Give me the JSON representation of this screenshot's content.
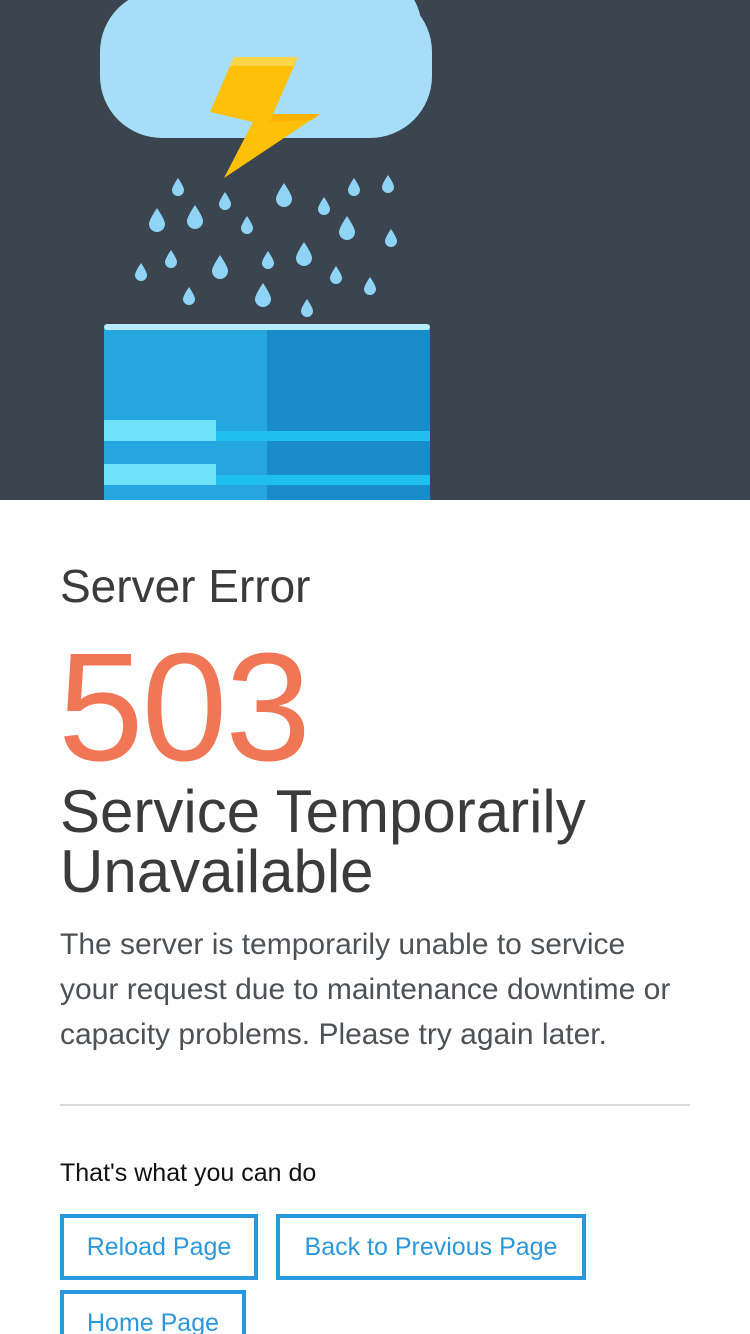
{
  "illustration": {
    "name": "storm-cloud-over-server",
    "colors": {
      "background": "#3a4550",
      "cloud": "#a6ddf7",
      "lightning": "#ffc107",
      "rain": "#8fd4f5",
      "server_light": "#26a6e1",
      "server_dark": "#1b8ccb",
      "server_stripe": "#6ee2f9"
    }
  },
  "error": {
    "subtitle": "Server Error",
    "code": "503",
    "title": "Service Temporarily Unavailable",
    "description": "The server is temporarily unable to service your request due to maintenance downtime or capacity problems. Please try again later."
  },
  "actions": {
    "heading": "That's what you can do",
    "reload_label": "Reload Page",
    "back_label": "Back to Previous Page",
    "home_label": "Home Page"
  },
  "colors": {
    "accent": "#2b97dc",
    "code": "#f07656",
    "text": "#3b3b3b"
  }
}
